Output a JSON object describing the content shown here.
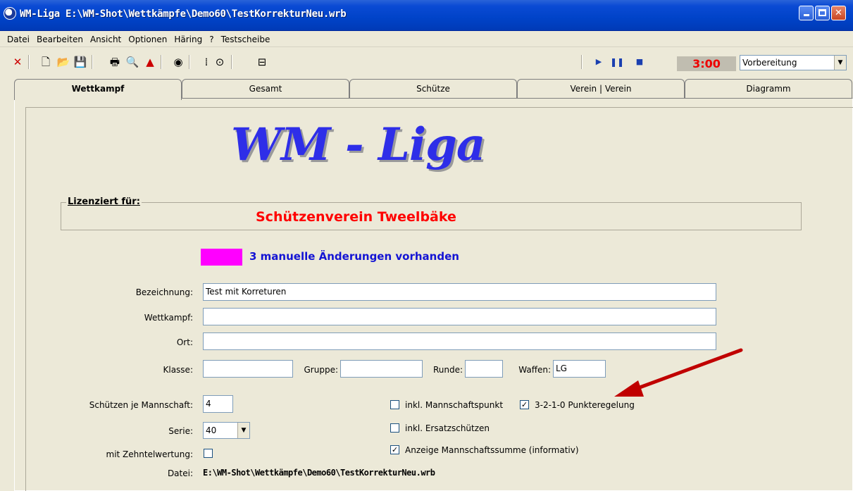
{
  "window": {
    "title": "WM-Liga E:\\WM-Shot\\Wettkämpfe\\Demo60\\TestKorrekturNeu.wrb"
  },
  "menu": [
    "Datei",
    "Bearbeiten",
    "Ansicht",
    "Optionen",
    "Häring",
    "?",
    "Testscheibe"
  ],
  "toolbar": {
    "timer": "3:00",
    "phase": "Vorbereitung",
    "icons": [
      "close-x",
      "new",
      "open",
      "save",
      "print",
      "preview",
      "export",
      "target",
      "score",
      "record",
      "list",
      "play",
      "pause",
      "stop"
    ]
  },
  "tabs": [
    "Wettkampf",
    "Gesamt",
    "Schütze",
    "Verein | Verein",
    "Diagramm"
  ],
  "logo": "WM - Liga",
  "license": {
    "legend": "Lizenziert für:",
    "club": "Schützenverein Tweelbäke"
  },
  "changes": {
    "text": "3 manuelle Änderungen vorhanden",
    "color": "#ff00ff"
  },
  "form": {
    "bezeichnung": {
      "label": "Bezeichnung:",
      "value": "Test mit Korreturen"
    },
    "wettkampf": {
      "label": "Wettkampf:",
      "value": ""
    },
    "ort": {
      "label": "Ort:",
      "value": ""
    },
    "klasse": {
      "label": "Klasse:",
      "value": ""
    },
    "gruppe": {
      "label": "Gruppe:",
      "value": ""
    },
    "runde": {
      "label": "Runde:",
      "value": ""
    },
    "waffen": {
      "label": "Waffen:",
      "value": "LG"
    },
    "schuetzen": {
      "label": "Schützen je Mannschaft:",
      "value": "4"
    },
    "serie": {
      "label": "Serie:",
      "value": "40"
    },
    "zehntel": {
      "label": "mit Zehntelwertung:",
      "checked": false
    },
    "datei": {
      "label": "Datei:",
      "value": "E:\\WM-Shot\\Wettkämpfe\\Demo60\\TestKorrekturNeu.wrb"
    }
  },
  "options": {
    "mannschaftspunkt": {
      "label": "inkl. Mannschaftspunkt",
      "checked": false
    },
    "punkteregelung": {
      "label": "3-2-1-0 Punkteregelung",
      "checked": true
    },
    "ersatzschuetzen": {
      "label": "inkl. Ersatzschützen",
      "checked": false
    },
    "mannschaftssumme": {
      "label": "Anzeige Mannschaftssumme (informativ)",
      "checked": true
    }
  },
  "colors": {
    "accent": "#2e2ee8",
    "club": "#ff0000",
    "timer": "#ee0000",
    "arrow": "#c00000"
  }
}
